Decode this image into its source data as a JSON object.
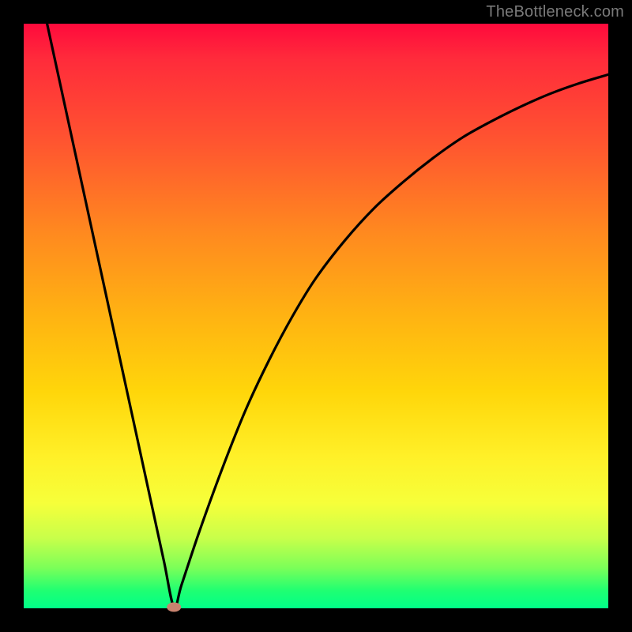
{
  "watermark": "TheBottleneck.com",
  "chart_data": {
    "type": "line",
    "title": "",
    "xlabel": "",
    "ylabel": "",
    "xlim": [
      0,
      100
    ],
    "ylim": [
      0,
      100
    ],
    "grid": false,
    "series": [
      {
        "name": "bottleneck-curve",
        "x": [
          4,
          6,
          8,
          10,
          12,
          14,
          16,
          18,
          20,
          22,
          24,
          25.7,
          27,
          30,
          34,
          38,
          42,
          46,
          50,
          55,
          60,
          65,
          70,
          75,
          80,
          85,
          90,
          95,
          100
        ],
        "values": [
          100,
          90.8,
          81.6,
          72.4,
          63.2,
          54,
          44.8,
          35.6,
          26.4,
          17.2,
          8,
          0.2,
          4,
          13,
          24,
          34,
          42.5,
          50,
          56.5,
          63,
          68.5,
          73,
          77,
          80.5,
          83.3,
          85.8,
          88,
          89.8,
          91.3
        ]
      }
    ],
    "marker": {
      "name": "optimum-point",
      "x": 25.7,
      "y": 0.2,
      "color": "#c8836f",
      "rx": 9,
      "ry": 6
    }
  }
}
